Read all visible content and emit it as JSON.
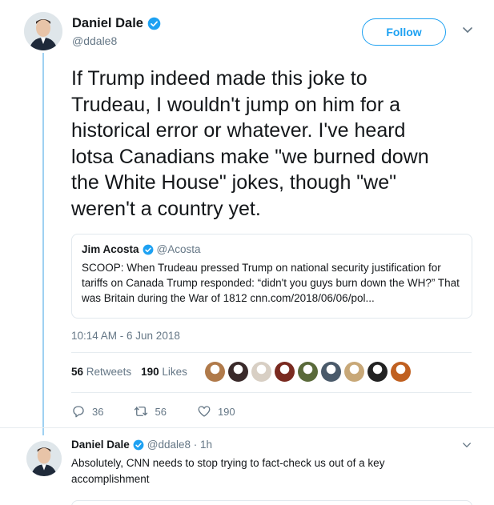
{
  "tweet": {
    "author_name": "Daniel Dale",
    "author_handle": "@ddale8",
    "follow_label": "Follow",
    "text": "If Trump indeed made this joke to\nTrudeau, I wouldn't jump on him for a\nhistorical error or whatever. I've heard\nlotsa Canadians make \"we burned down\nthe White House\" jokes, though \"we\"\nweren't a country yet.",
    "timestamp": "10:14 AM - 6 Jun 2018",
    "retweets_count": "56",
    "retweets_label": "Retweets",
    "likes_count": "190",
    "likes_label": "Likes",
    "actions": {
      "reply_count": "36",
      "retweet_count": "56",
      "like_count": "190"
    }
  },
  "quoted_tweet": {
    "author_name": "Jim Acosta",
    "author_handle": "@Acosta",
    "text": "SCOOP: When Trudeau pressed Trump on national security justification for tariffs on Canada Trump responded: “didn't you guys burn down the WH?” That was Britain during the War of 1812 cnn.com/2018/06/06/pol..."
  },
  "reply": {
    "author_name": "Daniel Dale",
    "meta": "@ddale8 · 1h",
    "text": "Absolutely, CNN needs to stop trying to fact-check us out of a key accomplishment"
  },
  "liker_colors": [
    "#b07a4a",
    "#3a2a2a",
    "#d8cfc4",
    "#7a2a20",
    "#5a6a3a",
    "#4a5a6a",
    "#c8a878",
    "#222222",
    "#c06020"
  ],
  "colors": {
    "accent": "#1da1f2",
    "verified": "#1da1f2",
    "thread_line": "#9fd1f2",
    "secondary_text": "#657786"
  },
  "icons": [
    "verified-badge-icon",
    "chevron-down-icon",
    "reply-icon",
    "retweet-icon",
    "like-icon"
  ]
}
